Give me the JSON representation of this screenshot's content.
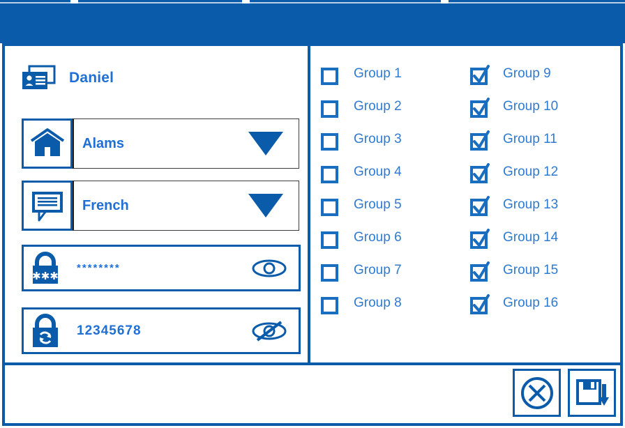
{
  "window": {
    "title": "",
    "accent_color": "#0b5bab",
    "text_color": "#1f6fd6",
    "label_color": "#2f7ad1",
    "background": "#ffffff"
  },
  "left_panel": {
    "user": {
      "icon": "id-card-stack-icon",
      "name": "Daniel"
    },
    "controls": [
      {
        "id": "site",
        "icon": "home-icon",
        "value": "Alams",
        "type": "dropdown",
        "caret": "chevron-down-icon"
      },
      {
        "id": "language",
        "icon": "language-bubble-icon",
        "value": "French",
        "type": "dropdown",
        "caret": "chevron-down-icon"
      }
    ],
    "password_fields": [
      {
        "id": "password",
        "icon": "lock-asterisks-icon",
        "value": "********",
        "masked": true,
        "toggle_icon": "eye-icon",
        "toggle_state": "hidden"
      },
      {
        "id": "confirm-password",
        "icon": "lock-refresh-icon",
        "value": "12345678",
        "masked": false,
        "toggle_icon": "eye-slash-icon",
        "toggle_state": "visible"
      }
    ]
  },
  "right_panel": {
    "columns": [
      {
        "items": [
          {
            "label": "Group 1",
            "checked": false
          },
          {
            "label": "Group 2",
            "checked": false
          },
          {
            "label": "Group 3",
            "checked": false
          },
          {
            "label": "Group 4",
            "checked": false
          },
          {
            "label": "Group 5",
            "checked": false
          },
          {
            "label": "Group 6",
            "checked": false
          },
          {
            "label": "Group 7",
            "checked": false
          },
          {
            "label": "Group 8",
            "checked": false
          }
        ]
      },
      {
        "items": [
          {
            "label": "Group 9",
            "checked": true
          },
          {
            "label": "Group 10",
            "checked": true
          },
          {
            "label": "Group 11",
            "checked": true
          },
          {
            "label": "Group 12",
            "checked": true
          },
          {
            "label": "Group 13",
            "checked": true
          },
          {
            "label": "Group 14",
            "checked": true
          },
          {
            "label": "Group 15",
            "checked": true
          },
          {
            "label": "Group 16",
            "checked": true
          }
        ]
      }
    ]
  },
  "footer": {
    "buttons": [
      {
        "id": "cancel",
        "icon": "circle-x-icon",
        "label": ""
      },
      {
        "id": "save",
        "icon": "save-download-icon",
        "label": ""
      }
    ]
  }
}
